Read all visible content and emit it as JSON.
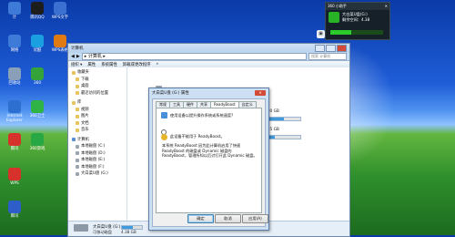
{
  "desktop": {
    "icons": [
      {
        "label": "计",
        "color": "#3e7bd9"
      },
      {
        "label": "腾讯QQ",
        "color": "#1d1d1d"
      },
      {
        "label": "WPS文字",
        "color": "#3b6fd0"
      },
      {
        "label": "网络",
        "color": "#3e7bd9"
      },
      {
        "label": "优酷",
        "color": "#1aa0e0"
      },
      {
        "label": "WPS表格",
        "color": "#e07b14"
      },
      {
        "label": "回收站",
        "color": "#8aa0b8"
      },
      {
        "label": "360",
        "color": "#33a33a"
      },
      {
        "label": "Internet Explorer",
        "color": "#2d6fd0"
      },
      {
        "label": "360卫士",
        "color": "#2fb344"
      },
      {
        "label": "腾讯",
        "color": "#d6322b"
      },
      {
        "label": "360游戏",
        "color": "#28a745"
      },
      {
        "label": "WPS",
        "color": "#d6322b"
      },
      {
        "label": "腾讯",
        "color": "#2e5ec8"
      }
    ]
  },
  "widget": {
    "title": "360 小助手",
    "line1": "大白菜U盘(G:)",
    "line2": "剩余空间：4.38"
  },
  "explorer": {
    "title": "计算机",
    "address": "▸ 计算机 ▸",
    "search_placeholder": "搜索 计算机",
    "toolbar": [
      "组织 ▾",
      "属性",
      "系统属性",
      "卸载或更改程序",
      "»"
    ],
    "nav": [
      {
        "label": "收藏夹",
        "type": "fav",
        "indent": false
      },
      {
        "label": "下载",
        "type": "fav",
        "indent": true
      },
      {
        "label": "桌面",
        "type": "fav",
        "indent": true
      },
      {
        "label": "最近访问的位置",
        "type": "fav",
        "indent": true
      },
      {
        "label": "",
        "type": "gap",
        "indent": false
      },
      {
        "label": "库",
        "type": "fav",
        "indent": false
      },
      {
        "label": "视频",
        "type": "fav",
        "indent": true
      },
      {
        "label": "图片",
        "type": "fav",
        "indent": true
      },
      {
        "label": "文档",
        "type": "fav",
        "indent": true
      },
      {
        "label": "音乐",
        "type": "fav",
        "indent": true
      },
      {
        "label": "",
        "type": "gap",
        "indent": false
      },
      {
        "label": "计算机",
        "type": "comp",
        "indent": false
      },
      {
        "label": "本地磁盘 (C:)",
        "type": "drv",
        "indent": true
      },
      {
        "label": "本地磁盘 (D:)",
        "type": "drv",
        "indent": true
      },
      {
        "label": "本地磁盘 (E:)",
        "type": "drv",
        "indent": true
      },
      {
        "label": "本地磁盘 (F:)",
        "type": "drv",
        "indent": true
      },
      {
        "label": "大白菜U盘 (G:)",
        "type": "drv",
        "indent": true
      }
    ],
    "drives": [
      {
        "label": "",
        "size": "100 GB",
        "used": 0.55
      },
      {
        "label": "",
        "size": "585 GB",
        "used": 0.3
      }
    ],
    "status": {
      "name": "大白菜U盘 (G:)",
      "type": "可移动磁盘",
      "free": "4.38 GB"
    }
  },
  "dialog": {
    "title": "大白菜U盘 (G:) 属性",
    "close": "✕",
    "tabs": [
      "常规",
      "工具",
      "硬件",
      "共享",
      "ReadyBoost",
      "自定义"
    ],
    "option_top": "使用设备以提升操作系统或系统速度?",
    "option_mid": "此设备不能用于 ReadyBoost。",
    "desc": "本系统 ReadyBoost 因为此计算机启用了快速 ReadyBoost 的磁盘或 Dynamic 磁盘的 ReadyBoost，管理所知以后讨打开此 Dynamic 磁盘。",
    "buttons": {
      "ok": "确定",
      "cancel": "取消",
      "apply": "应用(A)"
    }
  }
}
